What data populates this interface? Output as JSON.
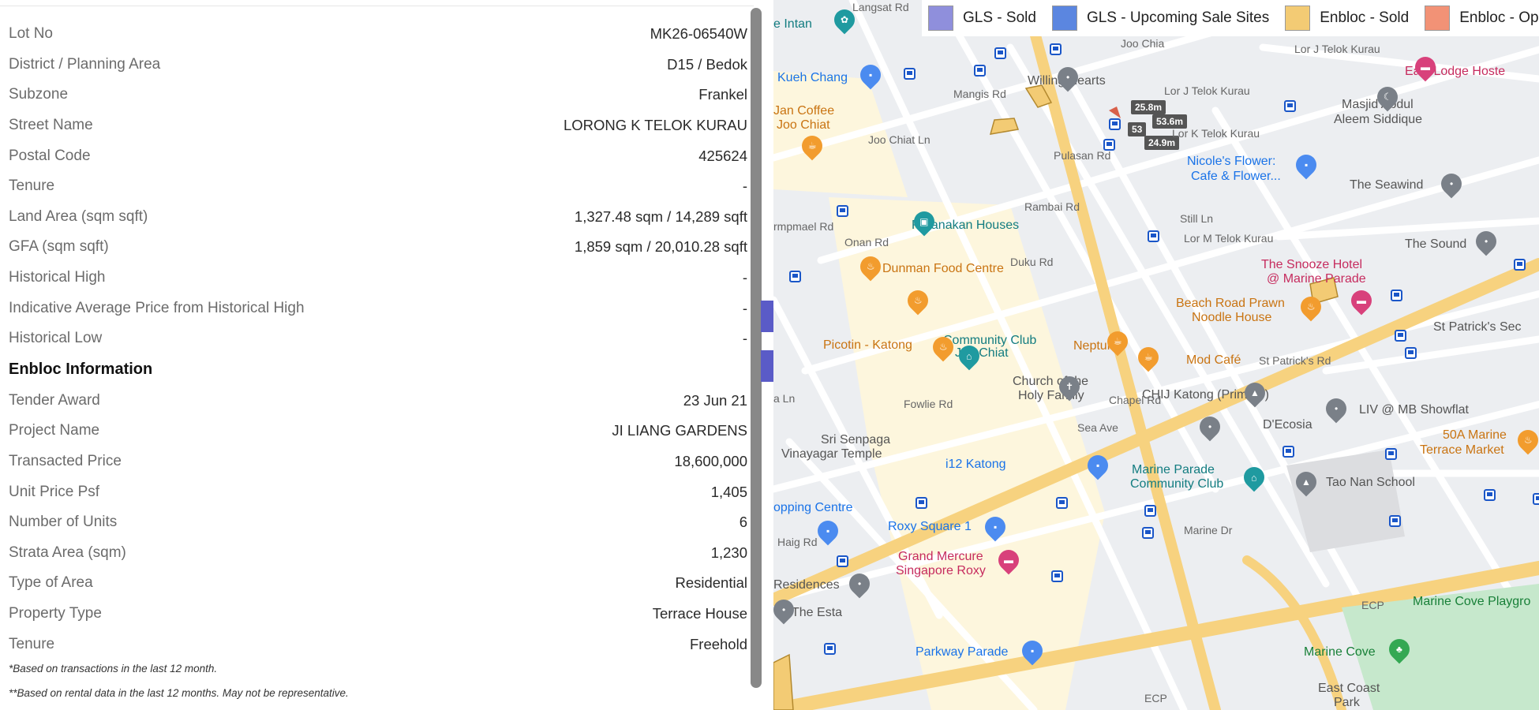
{
  "details": [
    {
      "label": "Lot No",
      "value": "MK26-06540W"
    },
    {
      "label": "District / Planning Area",
      "value": "D15 / Bedok"
    },
    {
      "label": "Subzone",
      "value": "Frankel"
    },
    {
      "label": "Street Name",
      "value": "LORONG K TELOK KURAU"
    },
    {
      "label": "Postal Code",
      "value": "425624"
    },
    {
      "label": "Tenure",
      "value": "-"
    },
    {
      "label": "Land Area (sqm sqft)",
      "value": "1,327.48 sqm / 14,289 sqft"
    },
    {
      "label": "GFA (sqm sqft)",
      "value": "1,859 sqm / 20,010.28 sqft"
    },
    {
      "label": "Historical High",
      "value": "-"
    },
    {
      "label": "Indicative Average Price from Historical High",
      "value": "-"
    },
    {
      "label": "Historical Low",
      "value": "-"
    }
  ],
  "enbloc": {
    "title": "Enbloc Information",
    "rows": [
      {
        "label": "Tender Award",
        "value": "23 Jun 21"
      },
      {
        "label": "Project Name",
        "value": "JI LIANG GARDENS"
      },
      {
        "label": "Transacted Price",
        "value": "18,600,000"
      },
      {
        "label": "Unit Price Psf",
        "value": "1,405"
      },
      {
        "label": "Number of Units",
        "value": "6"
      },
      {
        "label": "Strata Area (sqm)",
        "value": "1,230"
      },
      {
        "label": "Type of Area",
        "value": "Residential"
      },
      {
        "label": "Property Type",
        "value": "Terrace House"
      },
      {
        "label": "Tenure",
        "value": "Freehold"
      }
    ]
  },
  "notes": [
    "*Based on transactions in the last 12 month.",
    "**Based on rental data in the last 12 months. May not be representative."
  ],
  "toggles": {
    "expand": "›",
    "collapse": "‹"
  },
  "legend": [
    {
      "label": "GLS - Sold",
      "color": "#8f8fdc"
    },
    {
      "label": "GLS - Upcoming Sale Sites",
      "color": "#5b86e0"
    },
    {
      "label": "Enbloc - Sold",
      "color": "#f3cb74"
    },
    {
      "label": "Enbloc - Op",
      "color": "#f29276"
    }
  ],
  "map": {
    "places": [
      {
        "text": "Langsat Rd",
        "style": "road"
      },
      {
        "text": "e Intan",
        "style": "teal"
      },
      {
        "text": "Kueh Chang",
        "style": "blue"
      },
      {
        "text": "Jan Coffee",
        "style": "orange"
      },
      {
        "text": "Joo Chiat",
        "style": "orange"
      },
      {
        "text": "Willing Hearts",
        "style": "gray"
      },
      {
        "text": "East Lodge Hoste",
        "style": "pink"
      },
      {
        "text": "Masjid Abdul",
        "style": "gray"
      },
      {
        "text": "Aleem Siddique",
        "style": "gray"
      },
      {
        "text": "Nicole's Flower:",
        "style": "blue"
      },
      {
        "text": "Cafe & Flower...",
        "style": "blue"
      },
      {
        "text": "The Seawind",
        "style": "gray"
      },
      {
        "text": "Peranakan Houses",
        "style": "teal"
      },
      {
        "text": "The Sound",
        "style": "gray"
      },
      {
        "text": "Dunman Food Centre",
        "style": "orange"
      },
      {
        "text": "The Snooze Hotel",
        "style": "pink"
      },
      {
        "text": "@ Marine Parade",
        "style": "pink"
      },
      {
        "text": "Beach Road Prawn",
        "style": "orange"
      },
      {
        "text": "Noodle House",
        "style": "orange"
      },
      {
        "text": "St Patrick's Sec",
        "style": "gray"
      },
      {
        "text": "Joo Chiat",
        "style": "teal"
      },
      {
        "text": "Community Club",
        "style": "teal"
      },
      {
        "text": "Picotin - Katong",
        "style": "orange"
      },
      {
        "text": "Neptune",
        "style": "orange"
      },
      {
        "text": "Mod Café",
        "style": "orange"
      },
      {
        "text": "Church of the",
        "style": "gray"
      },
      {
        "text": "Holy Family",
        "style": "gray"
      },
      {
        "text": "CHIJ Katong (Primary)",
        "style": "gray"
      },
      {
        "text": "LIV @ MB Showflat",
        "style": "gray"
      },
      {
        "text": "D'Ecosia",
        "style": "gray"
      },
      {
        "text": "50A Marine",
        "style": "orange"
      },
      {
        "text": "Terrace Market",
        "style": "orange"
      },
      {
        "text": "Sri Senpaga",
        "style": "gray"
      },
      {
        "text": "Vinayagar Temple",
        "style": "gray"
      },
      {
        "text": "i12 Katong",
        "style": "blue"
      },
      {
        "text": "Marine Parade",
        "style": "teal"
      },
      {
        "text": "Community Club",
        "style": "teal"
      },
      {
        "text": "Tao Nan School",
        "style": "gray"
      },
      {
        "text": "opping Centre",
        "style": "blue"
      },
      {
        "text": "Roxy Square 1",
        "style": "blue"
      },
      {
        "text": "Grand Mercure",
        "style": "pink"
      },
      {
        "text": "Singapore Roxy",
        "style": "pink"
      },
      {
        "text": "Residences",
        "style": "gray"
      },
      {
        "text": "The Esta",
        "style": "gray"
      },
      {
        "text": "Parkway Parade",
        "style": "blue"
      },
      {
        "text": "Marine Cove Playgro",
        "style": "green"
      },
      {
        "text": "Marine Cove",
        "style": "green"
      },
      {
        "text": "East Coast",
        "style": "gray"
      },
      {
        "text": "Park",
        "style": "gray"
      },
      {
        "text": "ECP",
        "style": "road"
      },
      {
        "text": "ECP",
        "style": "road"
      }
    ],
    "roads": [
      "Joo Chiat Ln",
      "Mangis Rd",
      "Lor J Telok Kurau",
      "Lor J Telok Kurau",
      "Lor K Telok Kurau",
      "Pulasan Rd",
      "Rambai Rd",
      "Still Ln",
      "Lor M Telok Kurau",
      "Onan Rd",
      "Duku Rd",
      "rmpmael Rd",
      "Fowlie Rd",
      "Sea Ave",
      "Chapel Rd",
      "St Patrick's Rd",
      "Haig Rd",
      "Marine Dr",
      "Joo Chia",
      "a Ln"
    ],
    "measurements": [
      "25.8m",
      "53.6m",
      "53",
      "24.9m"
    ]
  }
}
